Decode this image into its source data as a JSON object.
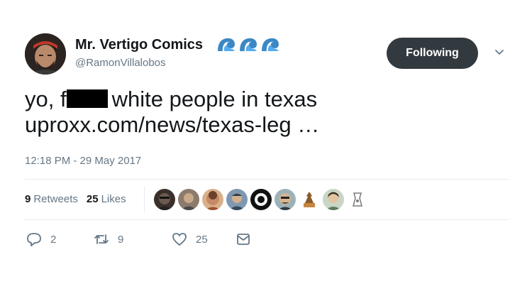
{
  "author": {
    "display_name": "Mr. Vertigo Comics",
    "handle": "@RamonVillalobos",
    "name_emoji_icons": [
      "wave-icon",
      "wave-icon",
      "wave-icon"
    ]
  },
  "follow_button": {
    "label": "Following"
  },
  "tweet": {
    "line1_prefix": "yo, f",
    "line1_suffix": "white people in texas",
    "link_text": "uproxx.com/news/texas-leg …",
    "timestamp": "12:18 PM - 29 May 2017"
  },
  "stats": {
    "retweets_count": "9",
    "retweets_label": "Retweets",
    "likes_count": "25",
    "likes_label": "Likes",
    "liker_avatar_count": 9
  },
  "actions": {
    "reply_count": "2",
    "retweet_count": "9",
    "like_count": "25"
  },
  "colors": {
    "text": "#14171a",
    "secondary": "#657786",
    "follow_button_bg": "#333a3f",
    "divider": "#e6ecf0",
    "wave_blue": "#3b88c3"
  }
}
